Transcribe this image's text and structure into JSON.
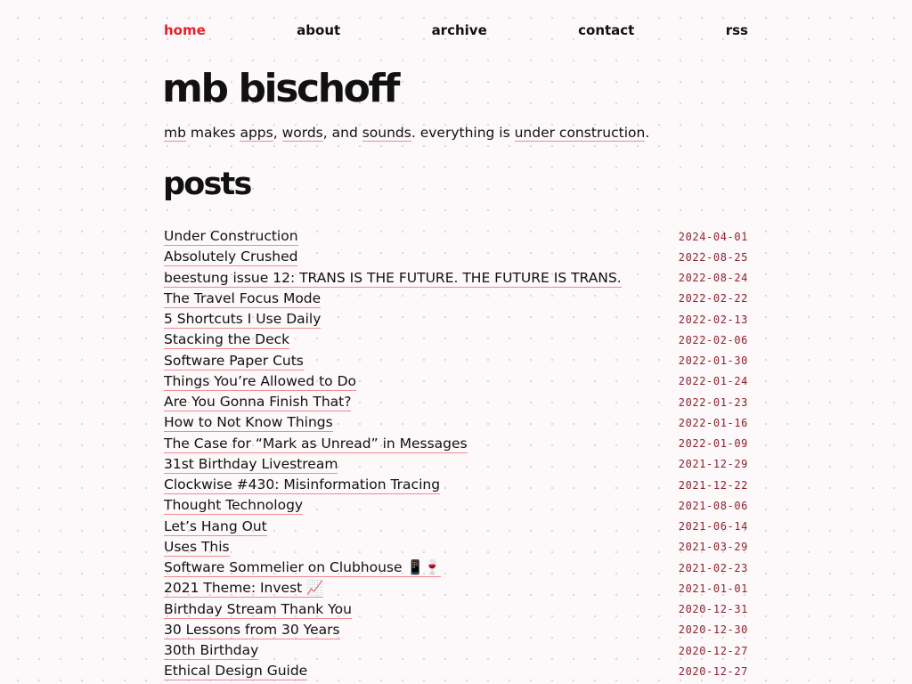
{
  "nav": {
    "items": [
      "home",
      "about",
      "archive",
      "contact",
      "rss"
    ],
    "active": "home"
  },
  "site": {
    "title": "mb bischoff",
    "tagline": {
      "mb": "mb",
      "t1": " makes ",
      "apps": "apps",
      "t2": ", ",
      "words": "words",
      "t3": ", and ",
      "sounds": "sounds",
      "t4": ". everything is ",
      "under_construction": "under construction",
      "t5": "."
    }
  },
  "posts": {
    "heading": "posts",
    "items": [
      {
        "title": "Under Construction",
        "date": "2024-04-01"
      },
      {
        "title": "Absolutely Crushed",
        "date": "2022-08-25"
      },
      {
        "title": "beestung issue 12: TRANS IS THE FUTURE. THE FUTURE IS TRANS.",
        "date": "2022-08-24"
      },
      {
        "title": "The Travel Focus Mode",
        "date": "2022-02-22"
      },
      {
        "title": "5 Shortcuts I Use Daily",
        "date": "2022-02-13"
      },
      {
        "title": "Stacking the Deck",
        "date": "2022-02-06"
      },
      {
        "title": "Software Paper Cuts",
        "date": "2022-01-30"
      },
      {
        "title": "Things You’re Allowed to Do",
        "date": "2022-01-24"
      },
      {
        "title": "Are You Gonna Finish That?",
        "date": "2022-01-23"
      },
      {
        "title": "How to Not Know Things",
        "date": "2022-01-16"
      },
      {
        "title": "The Case for “Mark as Unread” in Messages",
        "date": "2022-01-09"
      },
      {
        "title": "31st Birthday Livestream",
        "date": "2021-12-29"
      },
      {
        "title": "Clockwise #430: Misinformation Tracing",
        "date": "2021-12-22"
      },
      {
        "title": "Thought Technology",
        "date": "2021-08-06"
      },
      {
        "title": "Let’s Hang Out",
        "date": "2021-06-14"
      },
      {
        "title": "Uses This",
        "date": "2021-03-29"
      },
      {
        "title": "Software Sommelier on Clubhouse 📱🍷",
        "date": "2021-02-23"
      },
      {
        "title": "2021 Theme: Invest 📈",
        "date": "2021-01-01"
      },
      {
        "title": "Birthday Stream Thank You",
        "date": "2020-12-31"
      },
      {
        "title": "30 Lessons from 30 Years",
        "date": "2020-12-30"
      },
      {
        "title": "30th Birthday",
        "date": "2020-12-27"
      },
      {
        "title": "Ethical Design Guide",
        "date": "2020-12-27"
      }
    ]
  },
  "colors": {
    "background": "#fdf8f9",
    "accent": "#e8202b",
    "underline": "#f08a94",
    "date": "#8a2430",
    "text": "#111111"
  }
}
